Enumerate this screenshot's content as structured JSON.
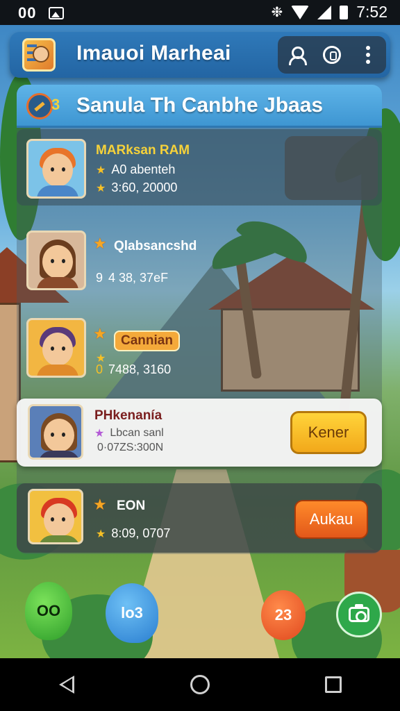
{
  "status_bar": {
    "left_text": "00",
    "time": "7:52"
  },
  "app_bar": {
    "title": "Imauoi Marheai",
    "icons": [
      "profile-icon",
      "badge-icon",
      "more-vert-icon"
    ]
  },
  "panel": {
    "header_badge": "3",
    "title": "Sanula Th Canbhe Jbaas"
  },
  "players": [
    {
      "name": "MARksan RAM",
      "line1": "A0 abenteh",
      "line2": "3:60, 20000",
      "name_color": "#f6d23a"
    },
    {
      "name": "Qlabsancshd",
      "line1": "4 38, 37eF",
      "line1_prefix": "9"
    },
    {
      "name": "Cannian",
      "line1": "7488, 3160",
      "line1_prefix": "0"
    },
    {
      "name": "PHkenanía",
      "line1": "Lbcan sanl",
      "line2": "0·07ZS:300N",
      "button": "Kener",
      "name_color": "#7a1e1e"
    },
    {
      "name": "EON",
      "line1": "8:09, 0707",
      "button": "Aukau"
    }
  ],
  "bottom_icons": [
    {
      "name": "green-monster-icon",
      "label": "OO"
    },
    {
      "name": "blue-bird-icon",
      "label": "lo3"
    },
    {
      "name": "orange-bubble-icon",
      "label": "23"
    },
    {
      "name": "camera-icon",
      "label": ""
    }
  ],
  "nav_bar": [
    "back-icon",
    "home-icon",
    "recent-apps-icon"
  ]
}
